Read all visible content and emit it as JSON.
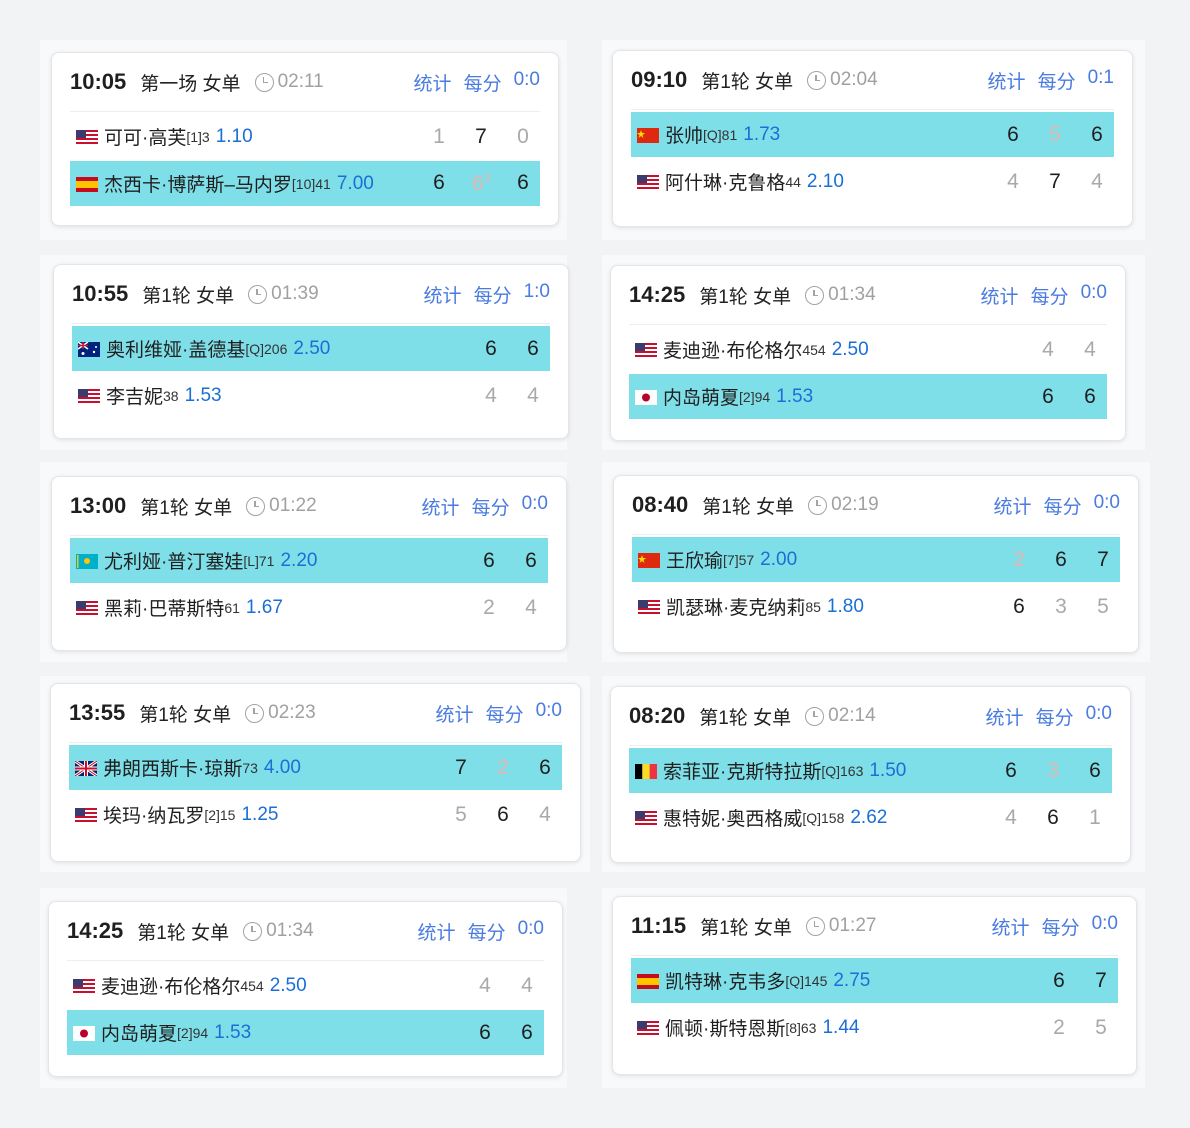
{
  "matches": [
    {
      "time": "10:05",
      "round": "第一场 女单",
      "duration": "02:11",
      "links": [
        "统计",
        "每分",
        "0:0"
      ],
      "players": [
        {
          "flag": "us",
          "name": "可可·高芙",
          "seed": "[1]3",
          "odds": "1.10",
          "scores": [
            "1",
            "7",
            "0"
          ],
          "states": [
            "lose",
            "win",
            "lose"
          ],
          "highlight": false
        },
        {
          "flag": "es",
          "name": "杰西卡·博萨斯–马内罗",
          "seed": "[10]41",
          "odds": "7.00",
          "scores": [
            "6",
            "6",
            "6"
          ],
          "states": [
            "win",
            "faint",
            "win"
          ],
          "tiebreak": [
            "",
            "3",
            ""
          ],
          "highlight": true
        }
      ]
    },
    {
      "time": "09:10",
      "round": "第1轮 女单",
      "duration": "02:04",
      "links": [
        "统计",
        "每分",
        "0:1"
      ],
      "players": [
        {
          "flag": "cn",
          "name": "张帅",
          "seed": "[Q]81",
          "odds": "1.73",
          "scores": [
            "6",
            "5",
            "6"
          ],
          "states": [
            "win",
            "faint",
            "win"
          ],
          "highlight": true
        },
        {
          "flag": "us",
          "name": "阿什琳·克鲁格",
          "seed": "44",
          "odds": "2.10",
          "scores": [
            "4",
            "7",
            "4"
          ],
          "states": [
            "lose",
            "win",
            "lose"
          ],
          "highlight": false
        }
      ]
    },
    {
      "time": "10:55",
      "round": "第1轮 女单",
      "duration": "01:39",
      "links": [
        "统计",
        "每分",
        "1:0"
      ],
      "players": [
        {
          "flag": "au",
          "name": "奥利维娅·盖德基",
          "seed": "[Q]206",
          "odds": "2.50",
          "scores": [
            "6",
            "6"
          ],
          "states": [
            "win",
            "win"
          ],
          "highlight": true
        },
        {
          "flag": "us",
          "name": "李吉妮",
          "seed": "38",
          "odds": "1.53",
          "scores": [
            "4",
            "4"
          ],
          "states": [
            "lose",
            "lose"
          ],
          "highlight": false
        }
      ]
    },
    {
      "time": "14:25",
      "round": "第1轮 女单",
      "duration": "01:34",
      "links": [
        "统计",
        "每分",
        "0:0"
      ],
      "players": [
        {
          "flag": "us",
          "name": "麦迪逊·布伦格尔",
          "seed": "454",
          "odds": "2.50",
          "scores": [
            "4",
            "4"
          ],
          "states": [
            "lose",
            "lose"
          ],
          "highlight": false
        },
        {
          "flag": "jp",
          "name": "内岛萌夏",
          "seed": "[2]94",
          "odds": "1.53",
          "scores": [
            "6",
            "6"
          ],
          "states": [
            "win",
            "win"
          ],
          "highlight": true
        }
      ]
    },
    {
      "time": "13:00",
      "round": "第1轮 女单",
      "duration": "01:22",
      "links": [
        "统计",
        "每分",
        "0:0"
      ],
      "players": [
        {
          "flag": "kz",
          "name": "尤利娅·普汀塞娃",
          "seed": "[L]71",
          "odds": "2.20",
          "scores": [
            "6",
            "6"
          ],
          "states": [
            "win",
            "win"
          ],
          "highlight": true
        },
        {
          "flag": "us",
          "name": "黑莉·巴蒂斯特",
          "seed": "61",
          "odds": "1.67",
          "scores": [
            "2",
            "4"
          ],
          "states": [
            "lose",
            "lose"
          ],
          "highlight": false
        }
      ]
    },
    {
      "time": "08:40",
      "round": "第1轮 女单",
      "duration": "02:19",
      "links": [
        "统计",
        "每分",
        "0:0"
      ],
      "players": [
        {
          "flag": "cn",
          "name": "王欣瑜",
          "seed": "[7]57",
          "odds": "2.00",
          "scores": [
            "2",
            "6",
            "7"
          ],
          "states": [
            "faint",
            "win",
            "win"
          ],
          "highlight": true
        },
        {
          "flag": "us",
          "name": "凯瑟琳·麦克纳莉",
          "seed": "85",
          "odds": "1.80",
          "scores": [
            "6",
            "3",
            "5"
          ],
          "states": [
            "win",
            "lose",
            "lose"
          ],
          "highlight": false
        }
      ]
    },
    {
      "time": "13:55",
      "round": "第1轮 女单",
      "duration": "02:23",
      "links": [
        "统计",
        "每分",
        "0:0"
      ],
      "players": [
        {
          "flag": "gb",
          "name": "弗朗西斯卡·琼斯",
          "seed": "73",
          "odds": "4.00",
          "scores": [
            "7",
            "2",
            "6"
          ],
          "states": [
            "win",
            "faint",
            "win"
          ],
          "highlight": true
        },
        {
          "flag": "us",
          "name": "埃玛·纳瓦罗",
          "seed": "[2]15",
          "odds": "1.25",
          "scores": [
            "5",
            "6",
            "4"
          ],
          "states": [
            "lose",
            "win",
            "lose"
          ],
          "highlight": false
        }
      ]
    },
    {
      "time": "08:20",
      "round": "第1轮 女单",
      "duration": "02:14",
      "links": [
        "统计",
        "每分",
        "0:0"
      ],
      "players": [
        {
          "flag": "be",
          "name": "索菲亚·克斯特拉斯",
          "seed": "[Q]163",
          "odds": "1.50",
          "scores": [
            "6",
            "3",
            "6"
          ],
          "states": [
            "win",
            "faint",
            "win"
          ],
          "highlight": true
        },
        {
          "flag": "us",
          "name": "惠特妮·奥西格威",
          "seed": "[Q]158",
          "odds": "2.62",
          "scores": [
            "4",
            "6",
            "1"
          ],
          "states": [
            "lose",
            "win",
            "lose"
          ],
          "highlight": false
        }
      ]
    },
    {
      "time": "14:25",
      "round": "第1轮 女单",
      "duration": "01:34",
      "links": [
        "统计",
        "每分",
        "0:0"
      ],
      "players": [
        {
          "flag": "us",
          "name": "麦迪逊·布伦格尔",
          "seed": "454",
          "odds": "2.50",
          "scores": [
            "4",
            "4"
          ],
          "states": [
            "lose",
            "lose"
          ],
          "highlight": false
        },
        {
          "flag": "jp",
          "name": "内岛萌夏",
          "seed": "[2]94",
          "odds": "1.53",
          "scores": [
            "6",
            "6"
          ],
          "states": [
            "win",
            "win"
          ],
          "highlight": true
        }
      ]
    },
    {
      "time": "11:15",
      "round": "第1轮 女单",
      "duration": "01:27",
      "links": [
        "统计",
        "每分",
        "0:0"
      ],
      "players": [
        {
          "flag": "es",
          "name": "凯特琳·克韦多",
          "seed": "[Q]145",
          "odds": "2.75",
          "scores": [
            "6",
            "7"
          ],
          "states": [
            "win",
            "win"
          ],
          "highlight": true
        },
        {
          "flag": "us",
          "name": "佩顿·斯特恩斯",
          "seed": "[8]63",
          "odds": "1.44",
          "scores": [
            "2",
            "5"
          ],
          "states": [
            "lose",
            "lose"
          ],
          "highlight": false
        }
      ]
    }
  ],
  "colors": {
    "highlight": "#7fdfe9",
    "link": "#4a7be0",
    "odds": "#1a6fd6"
  },
  "flag_icons": {
    "us": "us-flag-icon",
    "es": "spain-flag-icon",
    "cn": "china-flag-icon",
    "au": "australia-flag-icon",
    "jp": "japan-flag-icon",
    "kz": "kazakhstan-flag-icon",
    "gb": "uk-flag-icon",
    "be": "belgium-flag-icon"
  }
}
